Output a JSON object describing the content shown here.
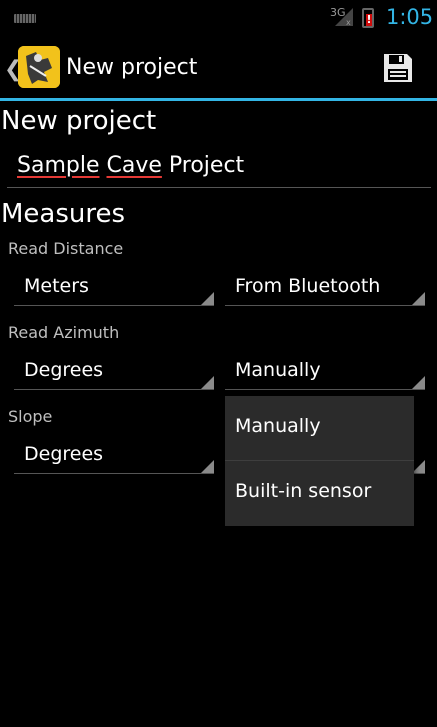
{
  "status_bar": {
    "network_label": "3G",
    "time": "1:05",
    "battery_warning": "!",
    "accent_color": "#33b5e5"
  },
  "action_bar": {
    "title": "New project",
    "back_icon": "chevron-left-icon",
    "app_icon": "cave-explorer-app-icon",
    "save_icon": "floppy-disk-icon"
  },
  "form": {
    "heading": "New project",
    "project_name": {
      "value_parts": [
        "Sample",
        "Cave",
        "Project"
      ],
      "misspelled": [
        true,
        true,
        false
      ]
    },
    "measures_heading": "Measures",
    "read_distance": {
      "label": "Read Distance",
      "unit": "Meters",
      "source": "From Bluetooth"
    },
    "read_azimuth": {
      "label": "Read Azimuth",
      "unit": "Degrees",
      "source": "Manually"
    },
    "slope": {
      "label": "Slope",
      "unit": "Degrees"
    }
  },
  "dropdown": {
    "options": [
      "Manually",
      "Built-in sensor"
    ]
  }
}
